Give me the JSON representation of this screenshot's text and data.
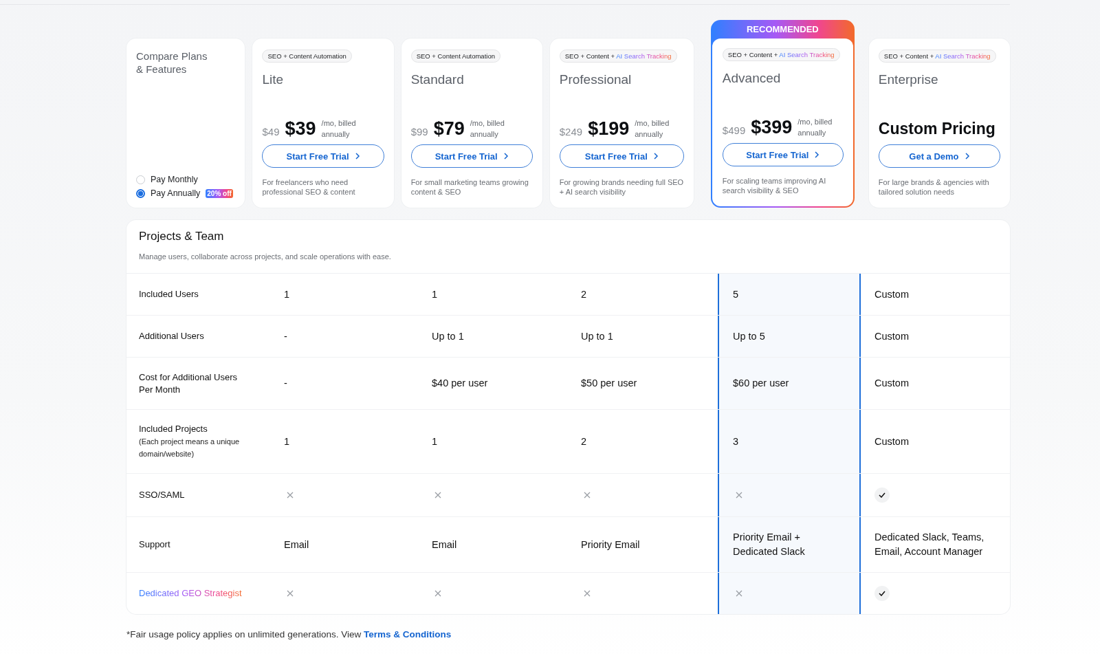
{
  "intro": {
    "title_lines": [
      "Compare Plans",
      "& Features"
    ],
    "billing_options": [
      {
        "label": "Pay Monthly",
        "selected": false
      },
      {
        "label": "Pay Annually",
        "selected": true,
        "badge": "20% off"
      }
    ]
  },
  "recommended_badge": "RECOMMENDED",
  "plans": [
    {
      "tag": {
        "text": "SEO + Content Automation"
      },
      "name": "Lite",
      "kind": "price",
      "old_price": "$49",
      "price": "$39",
      "price_note": "/mo, billed annually",
      "button": "Start Free Trial",
      "description": "For freelancers who need professional SEO & content",
      "recommended": false
    },
    {
      "tag": {
        "text": "SEO + Content Automation"
      },
      "name": "Standard",
      "kind": "price",
      "old_price": "$99",
      "price": "$79",
      "price_note": "/mo, billed annually",
      "button": "Start Free Trial",
      "description": "For small marketing teams growing content & SEO",
      "recommended": false
    },
    {
      "tag": {
        "text": "SEO + Content + ",
        "highlight": "AI Search Tracking"
      },
      "name": "Professional",
      "kind": "price",
      "old_price": "$249",
      "price": "$199",
      "price_note": "/mo, billed annually",
      "button": "Start Free Trial",
      "description": "For growing brands needing full SEO + AI search visibility",
      "recommended": false
    },
    {
      "tag": {
        "text": "SEO + Content + ",
        "highlight": "AI Search Tracking"
      },
      "name": "Advanced",
      "kind": "price",
      "old_price": "$499",
      "price": "$399",
      "price_note": "/mo, billed annually",
      "button": "Start Free Trial",
      "description": "For scaling teams improving AI search visibility & SEO",
      "recommended": true
    },
    {
      "tag": {
        "text": "SEO + Content + ",
        "highlight": "AI Search Tracking"
      },
      "name": "Enterprise",
      "kind": "custom",
      "price": "Custom Pricing",
      "button": "Get a Demo",
      "description": "For large brands & agencies with tailored solution needs",
      "recommended": false
    }
  ],
  "section": {
    "title": "Projects & Team",
    "subtitle": "Manage users, collaborate across projects, and scale operations with ease.",
    "rows": [
      {
        "label": "Included Users",
        "cells": [
          {
            "kind": "text",
            "text": "1"
          },
          {
            "kind": "text",
            "text": "1"
          },
          {
            "kind": "text",
            "text": "2"
          },
          {
            "kind": "text",
            "text": "5"
          },
          {
            "kind": "text",
            "text": "Custom"
          }
        ]
      },
      {
        "label": "Additional Users",
        "cells": [
          {
            "kind": "text",
            "text": "-"
          },
          {
            "kind": "text",
            "text": "Up to 1"
          },
          {
            "kind": "text",
            "text": "Up to 1"
          },
          {
            "kind": "text",
            "text": "Up to 5"
          },
          {
            "kind": "text",
            "text": "Custom"
          }
        ]
      },
      {
        "label": "Cost for Additional Users Per Month",
        "cells": [
          {
            "kind": "text",
            "text": "-"
          },
          {
            "kind": "text",
            "text": "$40 per user"
          },
          {
            "kind": "text",
            "text": "$50 per user"
          },
          {
            "kind": "text",
            "text": "$60 per user"
          },
          {
            "kind": "text",
            "text": "Custom"
          }
        ]
      },
      {
        "label": "Included Projects",
        "note": "(Each project means a unique domain/website)",
        "cells": [
          {
            "kind": "text",
            "text": "1"
          },
          {
            "kind": "text",
            "text": "1"
          },
          {
            "kind": "text",
            "text": "2"
          },
          {
            "kind": "text",
            "text": "3"
          },
          {
            "kind": "text",
            "text": "Custom"
          }
        ]
      },
      {
        "label": "SSO/SAML",
        "cells": [
          {
            "kind": "mark",
            "included": false
          },
          {
            "kind": "mark",
            "included": false
          },
          {
            "kind": "mark",
            "included": false
          },
          {
            "kind": "mark",
            "included": false
          },
          {
            "kind": "mark",
            "included": true
          }
        ]
      },
      {
        "label": "Support",
        "cells": [
          {
            "kind": "text",
            "text": "Email"
          },
          {
            "kind": "text",
            "text": "Email"
          },
          {
            "kind": "text",
            "text": "Priority Email"
          },
          {
            "kind": "text",
            "text": "Priority Email + Dedicated Slack"
          },
          {
            "kind": "text",
            "text": "Dedicated Slack, Teams, Email, Account Manager"
          }
        ]
      },
      {
        "label": "Dedicated GEO Strategist",
        "gradient": true,
        "cells": [
          {
            "kind": "mark",
            "included": false
          },
          {
            "kind": "mark",
            "included": false
          },
          {
            "kind": "mark",
            "included": false
          },
          {
            "kind": "mark",
            "included": false
          },
          {
            "kind": "mark",
            "included": true
          }
        ]
      }
    ]
  },
  "footer": {
    "text": "*Fair usage policy applies on unlimited generations. View ",
    "link": "Terms & Conditions"
  }
}
